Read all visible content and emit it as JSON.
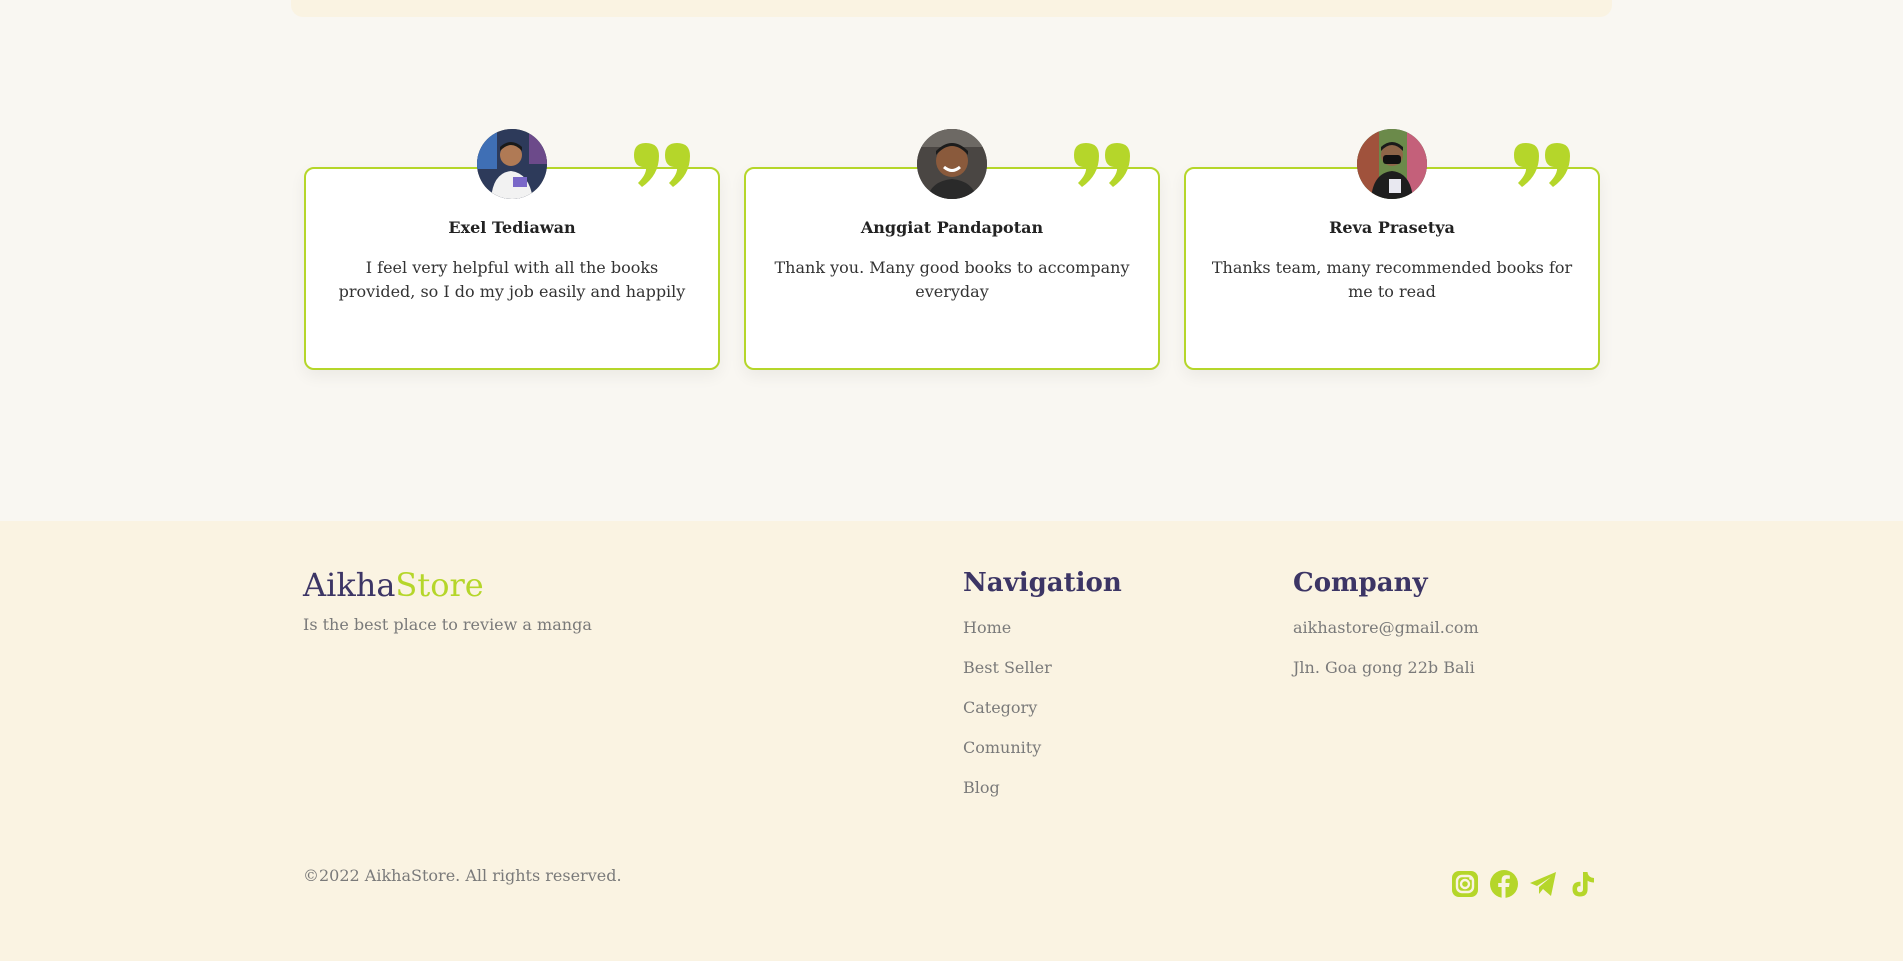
{
  "testimonials": [
    {
      "name": "Exel Tediawan",
      "text": "I feel very helpful with all the books provided, so I do my job easily and happily"
    },
    {
      "name": "Anggiat Pandapotan",
      "text": "Thank you. Many good books to accompany everyday"
    },
    {
      "name": "Reva Prasetya",
      "text": "Thanks team, many recommended books for me to read"
    }
  ],
  "footer": {
    "brand_main": "Aikha",
    "brand_accent": "Store",
    "tagline": "Is the best place to review a manga",
    "navigation": {
      "title": "Navigation",
      "links": [
        "Home",
        "Best Seller",
        "Category",
        "Comunity",
        "Blog"
      ]
    },
    "company": {
      "title": "Company",
      "email": "aikhastore@gmail.com",
      "address": "Jln. Goa gong 22b Bali"
    },
    "copyright": "©2022 AikhaStore. All rights reserved.",
    "social_icons": [
      "instagram-icon",
      "facebook-icon",
      "telegram-icon",
      "tiktok-icon"
    ]
  },
  "colors": {
    "accent": "#b5d62a",
    "brand_dark": "#3c3565",
    "footer_bg": "#faf3e2",
    "page_bg": "#f9f7f2"
  }
}
